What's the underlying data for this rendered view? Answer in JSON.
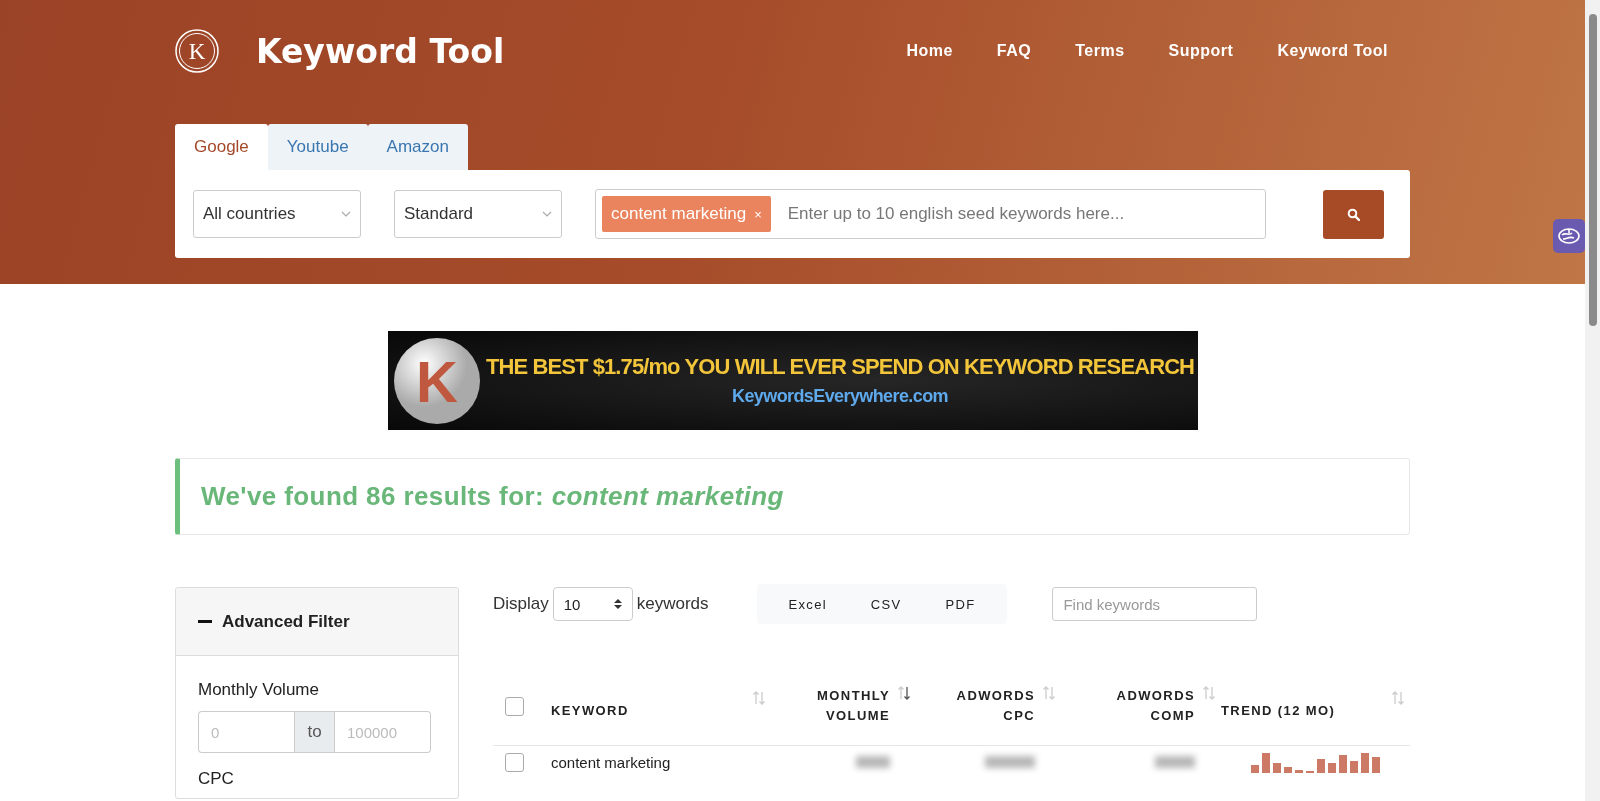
{
  "header": {
    "logo_letter": "K",
    "title": "Keyword Tool",
    "nav": [
      "Home",
      "FAQ",
      "Terms",
      "Support",
      "Keyword Tool"
    ]
  },
  "search": {
    "tabs": [
      {
        "label": "Google",
        "selected": true
      },
      {
        "label": "Youtube",
        "selected": false
      },
      {
        "label": "Amazon",
        "selected": false
      }
    ],
    "country": "All countries",
    "mode": "Standard",
    "tags": [
      {
        "label": "content marketing",
        "remove": "×"
      }
    ],
    "placeholder": "Enter up to 10 english seed keywords here..."
  },
  "banner": {
    "logo_letter": "K",
    "headline": "THE BEST $1.75/mo YOU WILL EVER SPEND ON KEYWORD RESEARCH",
    "url": "KeywordsEverywhere.com"
  },
  "results": {
    "text": "We've found 86 results for: *content marketing*"
  },
  "filter": {
    "title": "Advanced Filter",
    "expanded": true,
    "volume_label": "Monthly Volume",
    "from_placeholder": "0",
    "to_label": "to",
    "to_placeholder": "100000",
    "cpc_label": "CPC"
  },
  "toolbar": {
    "display_label": "Display",
    "page_size": "10",
    "suffix": "keywords",
    "exports": [
      "Excel",
      "CSV",
      "PDF"
    ],
    "find_placeholder": "Find keywords"
  },
  "table": {
    "header_checked": false,
    "columns": [
      {
        "label": "KEYWORD",
        "sorted": false
      },
      {
        "label": "MONTHLY VOLUME",
        "sorted": true
      },
      {
        "label": "ADWORDS CPC",
        "sorted": false
      },
      {
        "label": "ADWORDS COMP",
        "sorted": false
      },
      {
        "label": "TREND (12 MO)",
        "sorted": false
      }
    ],
    "rows": [
      {
        "keyword": "content marketing",
        "checked": false
      }
    ]
  }
}
